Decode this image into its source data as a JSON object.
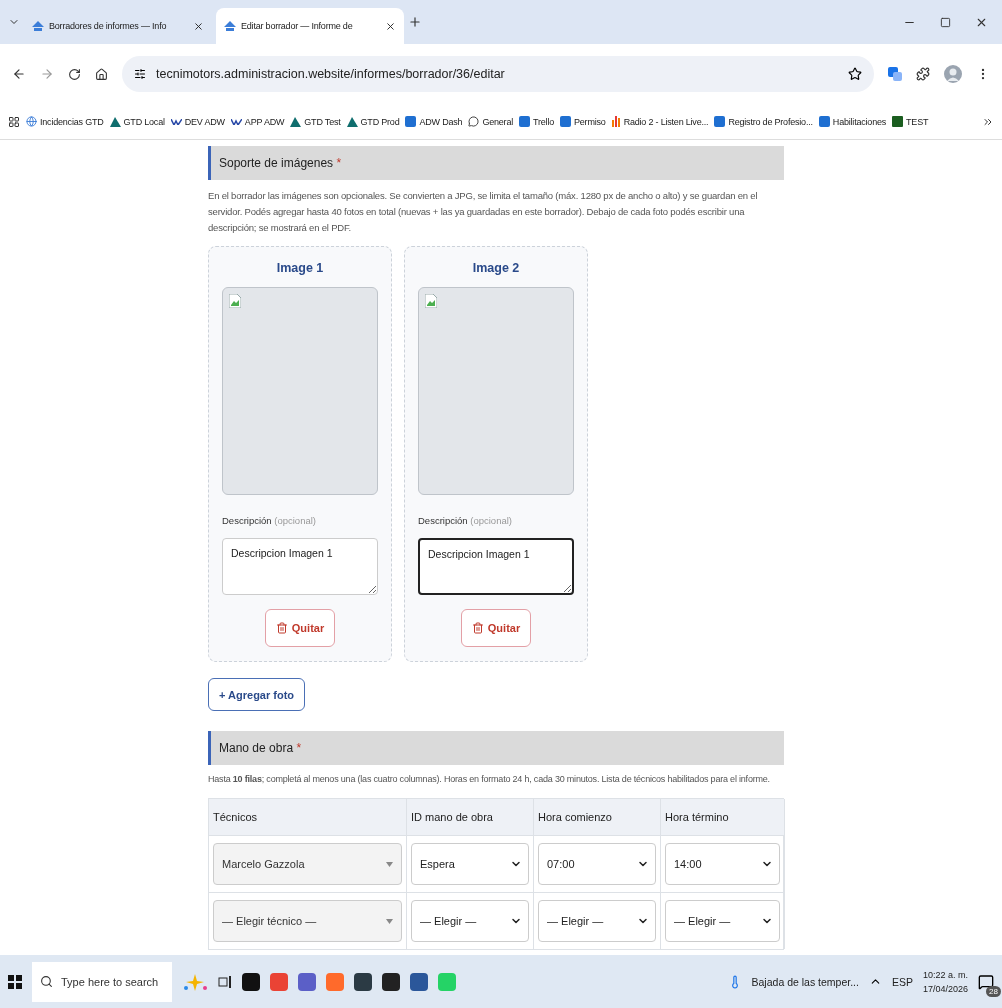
{
  "browser": {
    "tabs": [
      {
        "title": "Borradores de informes — Info",
        "selected": false
      },
      {
        "title": "Editar borrador — Informe de",
        "selected": true
      }
    ],
    "address": "tecnimotors.administracion.website/informes/borrador/36/editar",
    "bookmarks": [
      {
        "label": "Incidencias GTD",
        "kind": "globe"
      },
      {
        "label": "GTD Local",
        "kind": "gtd"
      },
      {
        "label": "DEV ADW",
        "kind": "adw"
      },
      {
        "label": "APP ADW",
        "kind": "adw"
      },
      {
        "label": "GTD Test",
        "kind": "gtd"
      },
      {
        "label": "GTD Prod",
        "kind": "gtd"
      },
      {
        "label": "ADW Dash",
        "kind": "app"
      },
      {
        "label": "General",
        "kind": "chat"
      },
      {
        "label": "Trello",
        "kind": "app"
      },
      {
        "label": "Permiso",
        "kind": "app"
      },
      {
        "label": "Radio 2 - Listen Live...",
        "kind": "radio"
      },
      {
        "label": "Registro de Profesio...",
        "kind": "app"
      },
      {
        "label": "Habilitaciones",
        "kind": "app"
      },
      {
        "label": "TEST",
        "kind": "test"
      }
    ]
  },
  "images_section": {
    "title": "Soporte de imágenes",
    "required_mark": "*",
    "description": "En el borrador las imágenes son opcionales. Se convierten a JPG, se limita el tamaño (máx. 1280 px de ancho o alto) y se guardan en el servidor. Podés agregar hasta 40 fotos en total (nuevas + las ya guardadas en este borrador). Debajo de cada foto podés escribir una descripción; se mostrará en el PDF.",
    "cards": [
      {
        "title": "Image 1",
        "label": "Descripción",
        "hint": "(opcional)",
        "value": "Descripcion Imagen 1",
        "focused": false,
        "remove_label": "Quitar"
      },
      {
        "title": "Image 2",
        "label": "Descripción",
        "hint": "(opcional)",
        "value": "Descripcion Imagen 1",
        "focused": true,
        "remove_label": "Quitar"
      }
    ],
    "add_label": "+ Agregar foto"
  },
  "labor_section": {
    "title": "Mano de obra",
    "required_mark": "*",
    "note": "Hasta **10 filas**; completá al menos una (las cuatro columnas). Horas en formato 24 h, cada 30 minutos. Lista de técnicos habilitados para el informe.",
    "columns": [
      "Técnicos",
      "ID mano de obra",
      "Hora comienzo",
      "Hora término"
    ],
    "rows": [
      [
        {
          "kind": "combo",
          "value": "Marcelo Gazzola"
        },
        {
          "kind": "select",
          "value": "Espera"
        },
        {
          "kind": "select",
          "value": "07:00"
        },
        {
          "kind": "select",
          "value": "14:00"
        }
      ],
      [
        {
          "kind": "combo",
          "value": "— Elegir técnico —"
        },
        {
          "kind": "select",
          "value": "— Elegir —"
        },
        {
          "kind": "select",
          "value": "— Elegir —"
        },
        {
          "kind": "select",
          "value": "— Elegir —"
        }
      ]
    ]
  },
  "taskbar": {
    "search_placeholder": "Type here to search",
    "weather": "Bajada de las temper...",
    "language": "ESP",
    "time": "10:22 a. m.",
    "date": "17/04/2026",
    "notifications": "28"
  }
}
